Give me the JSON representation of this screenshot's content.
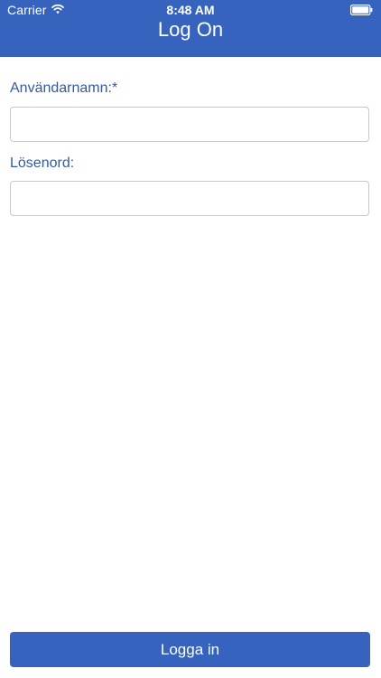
{
  "status_bar": {
    "carrier": "Carrier",
    "time": "8:48 AM",
    "wifi_icon": "wifi-icon",
    "battery_icon": "battery-icon"
  },
  "nav": {
    "title": "Log On"
  },
  "form": {
    "username_label": "Användarnamn:*",
    "username_value": "",
    "username_placeholder": "",
    "password_label": "Lösenord:",
    "password_value": "",
    "password_placeholder": ""
  },
  "actions": {
    "login_label": "Logga in"
  },
  "colors": {
    "accent": "#3563bd",
    "label": "#2f5ba8",
    "input_border": "#c8c8cc"
  }
}
